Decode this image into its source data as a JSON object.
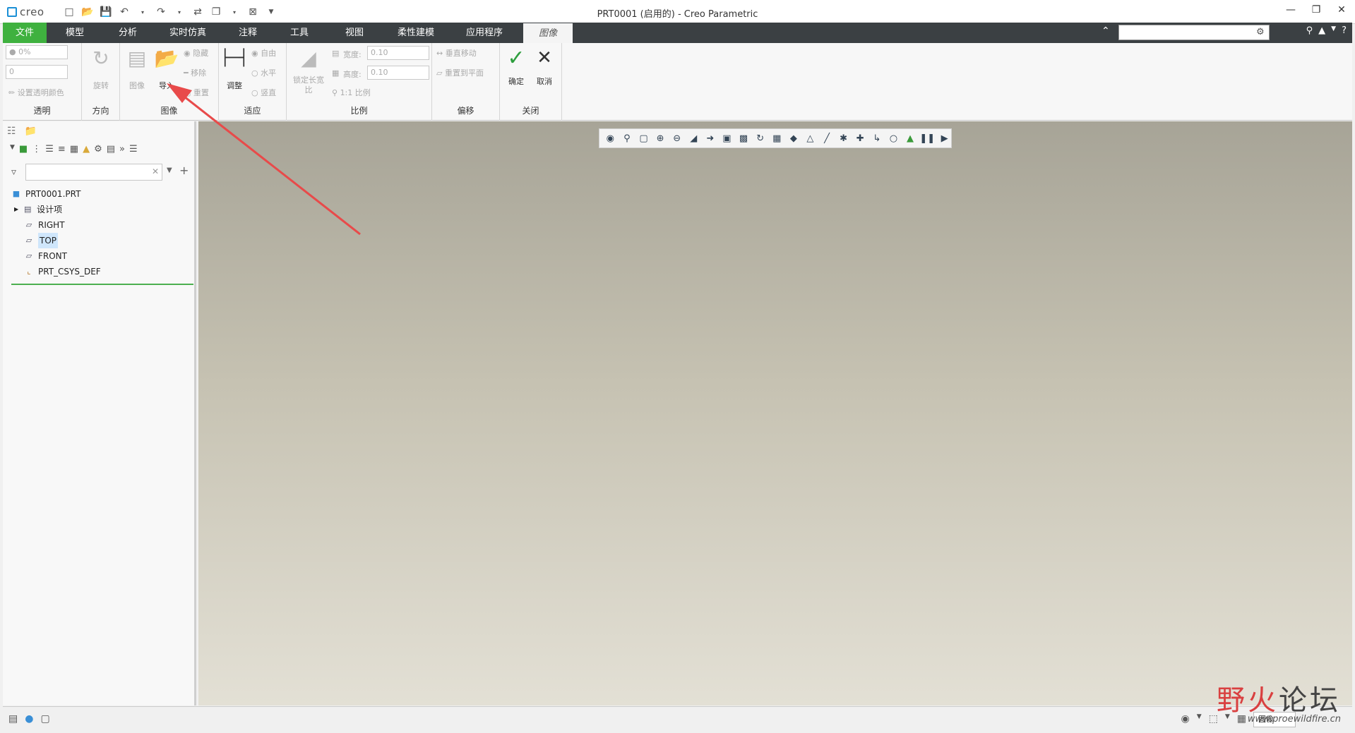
{
  "app": {
    "logo_text": "creo",
    "window_title": "PRT0001 (启用的) - Creo Parametric"
  },
  "tabs": {
    "file": "文件",
    "model": "模型",
    "analysis": "分析",
    "simulate": "实时仿真",
    "annotate": "注释",
    "tools": "工具",
    "view": "视图",
    "flexible": "柔性建模",
    "apps": "应用程序",
    "image": "图像"
  },
  "ribbon": {
    "transparency": {
      "label": "透明",
      "percent_value": "0%",
      "numeric_value": "0",
      "set_color": "设置透明颜色"
    },
    "orientation": {
      "label": "方向",
      "rotate": "旋转"
    },
    "image": {
      "label": "图像",
      "image_btn": "图像",
      "import_btn": "导入",
      "hide": "隐藏",
      "remove": "移除",
      "reset": "重置"
    },
    "fit": {
      "label": "适应",
      "adjust": "调整",
      "free": "自由",
      "horizontal": "水平",
      "vertical": "竖直"
    },
    "scale": {
      "label": "比例",
      "lock_aspect": "锁定长宽比",
      "width_label": "宽度:",
      "width_value": "0.10",
      "height_label": "高度:",
      "height_value": "0.10",
      "one_to_one": "1:1 比例"
    },
    "offset": {
      "label": "偏移",
      "vertical_move": "垂直移动",
      "reset_to_plane": "重置到平面"
    },
    "close": {
      "label": "关闭",
      "ok": "确定",
      "cancel": "取消"
    }
  },
  "model_tree": {
    "root": "PRT0001.PRT",
    "items": [
      {
        "label": "设计项",
        "icon": "layer-icon"
      },
      {
        "label": "RIGHT",
        "icon": "datum-plane-icon"
      },
      {
        "label": "TOP",
        "icon": "datum-plane-icon",
        "selected": true
      },
      {
        "label": "FRONT",
        "icon": "datum-plane-icon"
      },
      {
        "label": "PRT_CSYS_DEF",
        "icon": "csys-icon"
      }
    ]
  },
  "statusbar": {
    "filter_value": "图像"
  },
  "watermark": {
    "part1": "野火",
    "part2": "论坛",
    "url": "www.proewildfire.cn"
  },
  "colors": {
    "file_tab": "#3fb13f",
    "tab_bar": "#3b4043",
    "arrow": "#e84a4a",
    "ok_check": "#2e9e3e"
  }
}
